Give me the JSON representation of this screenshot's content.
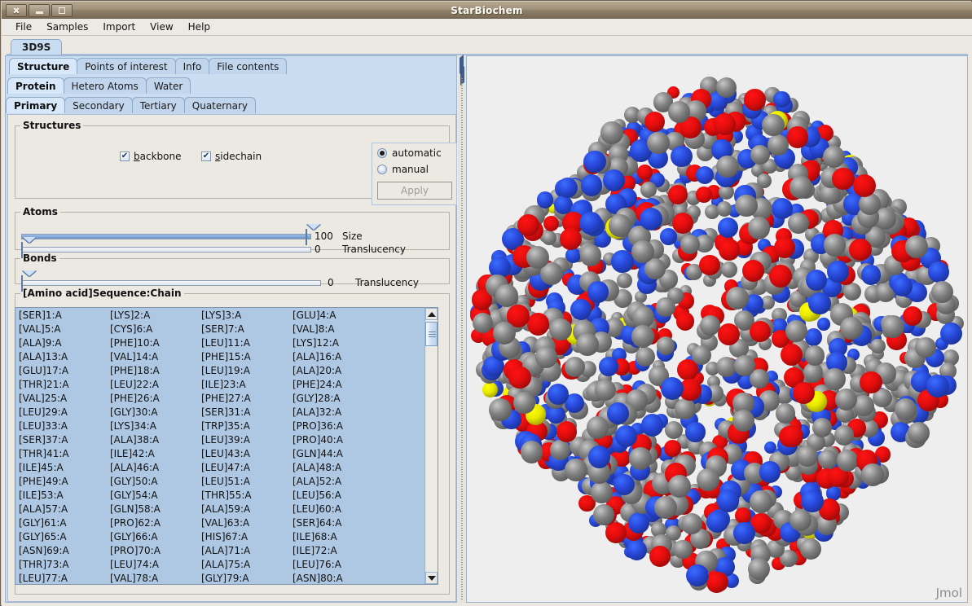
{
  "window": {
    "title": "StarBiochem",
    "controls": [
      {
        "name": "close-button",
        "glyph": "✕"
      },
      {
        "name": "minimize-button",
        "glyph": "—"
      },
      {
        "name": "maximize-button",
        "glyph": "□"
      }
    ]
  },
  "menubar": {
    "items": [
      "File",
      "Samples",
      "Import",
      "View",
      "Help"
    ]
  },
  "document_tabs": [
    {
      "label": "3D9S",
      "selected": true
    }
  ],
  "tabs_level1": [
    {
      "label": "Structure",
      "selected": true
    },
    {
      "label": "Points of interest",
      "selected": false
    },
    {
      "label": "Info",
      "selected": false
    },
    {
      "label": "File contents",
      "selected": false
    }
  ],
  "tabs_level2": [
    {
      "label": "Protein",
      "selected": true
    },
    {
      "label": "Hetero Atoms",
      "selected": false
    },
    {
      "label": "Water",
      "selected": false
    }
  ],
  "tabs_level3": [
    {
      "label": "Primary",
      "selected": true
    },
    {
      "label": "Secondary",
      "selected": false
    },
    {
      "label": "Tertiary",
      "selected": false
    },
    {
      "label": "Quaternary",
      "selected": false
    }
  ],
  "structures_group": {
    "legend": "Structures",
    "checkboxes": [
      {
        "label": "backbone",
        "mnemonic": "b",
        "rest": "ackbone",
        "checked": true,
        "checkmark": "✔"
      },
      {
        "label": "sidechain",
        "mnemonic": "s",
        "rest": "idechain",
        "checked": true,
        "checkmark": "✔"
      }
    ],
    "radios": [
      {
        "label": "automatic",
        "selected": true
      },
      {
        "label": "manual",
        "selected": false
      }
    ],
    "apply_label": "Apply",
    "apply_enabled": false
  },
  "atoms_group": {
    "legend": "Atoms",
    "sliders": [
      {
        "label": "Size",
        "value": "100",
        "percent": 100
      },
      {
        "label": "Translucency",
        "value": "0",
        "percent": 0
      }
    ]
  },
  "bonds_group": {
    "legend": "Bonds",
    "sliders": [
      {
        "label": "Translucency",
        "value": "0",
        "percent": 0
      }
    ]
  },
  "sequence_group": {
    "legend": "[Amino acid]Sequence:Chain",
    "columns": 4,
    "rows": [
      [
        "[SER]1:A",
        "[LYS]2:A",
        "[LYS]3:A",
        "[GLU]4:A"
      ],
      [
        "[VAL]5:A",
        "[CYS]6:A",
        "[SER]7:A",
        "[VAL]8:A"
      ],
      [
        "[ALA]9:A",
        "[PHE]10:A",
        "[LEU]11:A",
        "[LYS]12:A"
      ],
      [
        "[ALA]13:A",
        "[VAL]14:A",
        "[PHE]15:A",
        "[ALA]16:A"
      ],
      [
        "[GLU]17:A",
        "[PHE]18:A",
        "[LEU]19:A",
        "[ALA]20:A"
      ],
      [
        "[THR]21:A",
        "[LEU]22:A",
        "[ILE]23:A",
        "[PHE]24:A"
      ],
      [
        "[VAL]25:A",
        "[PHE]26:A",
        "[PHE]27:A",
        "[GLY]28:A"
      ],
      [
        "[LEU]29:A",
        "[GLY]30:A",
        "[SER]31:A",
        "[ALA]32:A"
      ],
      [
        "[LEU]33:A",
        "[LYS]34:A",
        "[TRP]35:A",
        "[PRO]36:A"
      ],
      [
        "[SER]37:A",
        "[ALA]38:A",
        "[LEU]39:A",
        "[PRO]40:A"
      ],
      [
        "[THR]41:A",
        "[ILE]42:A",
        "[LEU]43:A",
        "[GLN]44:A"
      ],
      [
        "[ILE]45:A",
        "[ALA]46:A",
        "[LEU]47:A",
        "[ALA]48:A"
      ],
      [
        "[PHE]49:A",
        "[GLY]50:A",
        "[LEU]51:A",
        "[ALA]52:A"
      ],
      [
        "[ILE]53:A",
        "[GLY]54:A",
        "[THR]55:A",
        "[LEU]56:A"
      ],
      [
        "[ALA]57:A",
        "[GLN]58:A",
        "[ALA]59:A",
        "[LEU]60:A"
      ],
      [
        "[GLY]61:A",
        "[PRO]62:A",
        "[VAL]63:A",
        "[SER]64:A"
      ],
      [
        "[GLY]65:A",
        "[GLY]66:A",
        "[HIS]67:A",
        "[ILE]68:A"
      ],
      [
        "[ASN]69:A",
        "[PRO]70:A",
        "[ALA]71:A",
        "[ILE]72:A"
      ],
      [
        "[THR]73:A",
        "[LEU]74:A",
        "[ALA]75:A",
        "[LEU]76:A"
      ],
      [
        "[LEU]77:A",
        "[VAL]78:A",
        "[GLY]79:A",
        "[ASN]80:A"
      ]
    ]
  },
  "viewer": {
    "watermark": "Jmol",
    "background": "#eeeeee",
    "atom_colors": {
      "carbon": "#808080",
      "nitrogen": "#2747d8",
      "oxygen": "#e10d0d",
      "sulfur": "#e8e800"
    },
    "representation": "space-filling"
  }
}
